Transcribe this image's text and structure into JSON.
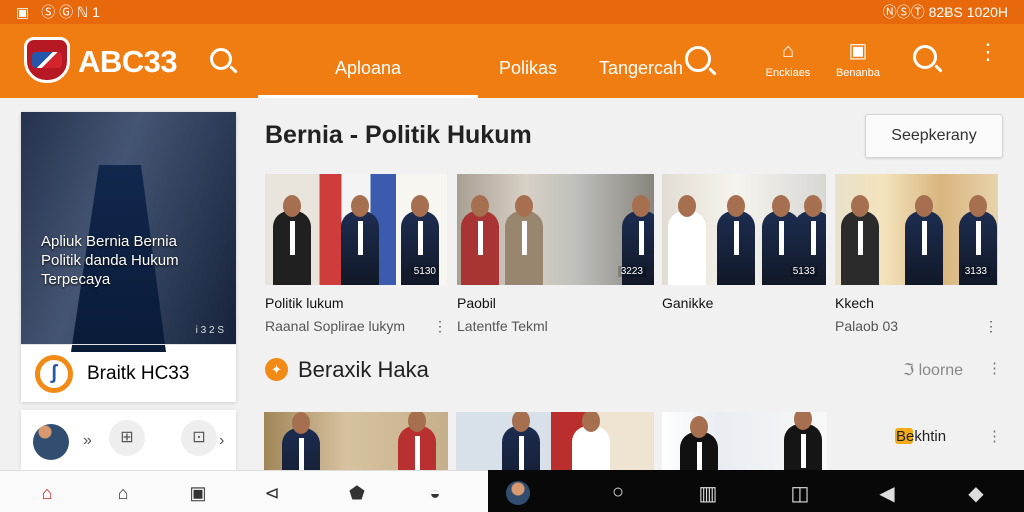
{
  "status": {
    "left_icons": [
      "gallery-icon",
      "image-icon",
      "record-icon",
      "signal-icon",
      "notification-icon"
    ],
    "left_text": "Ⓢ Ⓖ ℕ 1",
    "right_text": "ⓃⓈⓉ 82ɃS 1020H",
    "colors": {
      "bar": "#e8680c"
    }
  },
  "app": {
    "brand": "ABC33",
    "tabs": [
      "Aploana",
      "Polikas",
      "Tangercah"
    ],
    "actions": [
      {
        "label": "Enckiaes",
        "icon": "suitcase-icon"
      },
      {
        "label": "Benanba",
        "icon": "image-icon"
      }
    ],
    "accent": "#f07d12"
  },
  "featured": {
    "title": "Apliuk Bernia Bernia Politik danda Hukum Terpecaya",
    "code": "i 3 2 S",
    "brand_line": "Braitk HC33"
  },
  "main": {
    "heading": "Bernia - Politik Hukum",
    "subscribe": "Seepkerany"
  },
  "videos": [
    {
      "title": "Politik lukum",
      "meta": "Raanal Soplirae lukym",
      "duration": "5130"
    },
    {
      "title": "Paobil",
      "meta": "Latentfe Tekml",
      "duration": "3223"
    },
    {
      "title": "Ganikke",
      "meta": "",
      "duration": "5133"
    },
    {
      "title": "Kkech",
      "meta": "Palaob 03",
      "duration": "3133"
    }
  ],
  "section": {
    "title": "Beraxik Haka",
    "more": "ℑ loorne",
    "label": "Bekhtin"
  },
  "bottom_nav": [
    "home",
    "house",
    "grid",
    "send",
    "shield",
    "cloud"
  ],
  "android_nav": [
    "avatar",
    "search",
    "box",
    "cube",
    "back",
    "target"
  ]
}
